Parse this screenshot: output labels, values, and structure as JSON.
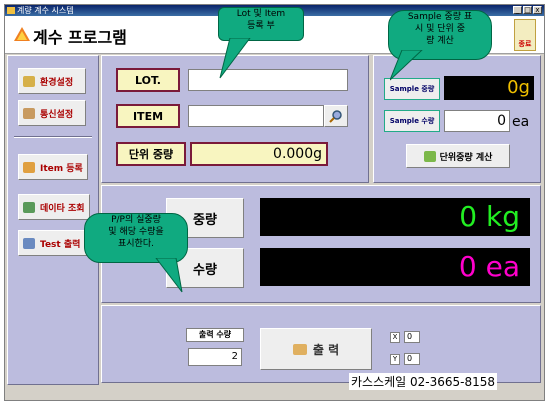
{
  "window": {
    "title": "계량 계수 시스템",
    "btn_min": "_",
    "btn_max": "□",
    "btn_close": "x"
  },
  "header": {
    "app_title": "계수 프로그램",
    "end_button": "종료"
  },
  "sidebar": {
    "items": [
      {
        "label": "환경설정",
        "icon": "settings-icon"
      },
      {
        "label": "통신설정",
        "icon": "connection-icon"
      },
      {
        "label": "Item 등록",
        "icon": "item-register-icon"
      },
      {
        "label": "데이타 조회",
        "icon": "data-search-icon"
      },
      {
        "label": "Test 출력",
        "icon": "print-icon"
      }
    ]
  },
  "form": {
    "lot_label": "LOT.",
    "lot_value": "",
    "item_label": "ITEM",
    "item_value": "",
    "unit_weight_label": "단위 중량",
    "unit_weight_value": "0.000g"
  },
  "sample": {
    "weight_label": "Sample 중량",
    "weight_value": "0g",
    "count_label": "Sample 수량",
    "count_value": "0",
    "count_unit": "ea",
    "calc_button": "단위중량 계산"
  },
  "display": {
    "weight_label": "중량",
    "weight_value": "0 kg",
    "count_label": "수량",
    "count_value": "0 ea"
  },
  "output": {
    "count_label": "출력 수량",
    "count_value": "2",
    "print_button": "출 력",
    "x_label": "X",
    "x_value": "0",
    "y_label": "Y",
    "y_value": "0"
  },
  "notes": {
    "lot_note": "Lot 및 Item\n등록 부",
    "sample_note": "Sample 중량 표\n시 및 단위 중\n량 계산",
    "display_note": "P/P의 실중량\n및 해당 수량을\n표시한다."
  },
  "footer": {
    "company": "카스스케일 02-3665-8158"
  },
  "colors": {
    "green_text": "#22ee22",
    "magenta_text": "#ff00cc",
    "yellow_text": "#f0c000",
    "panel": "#bcbcde"
  }
}
